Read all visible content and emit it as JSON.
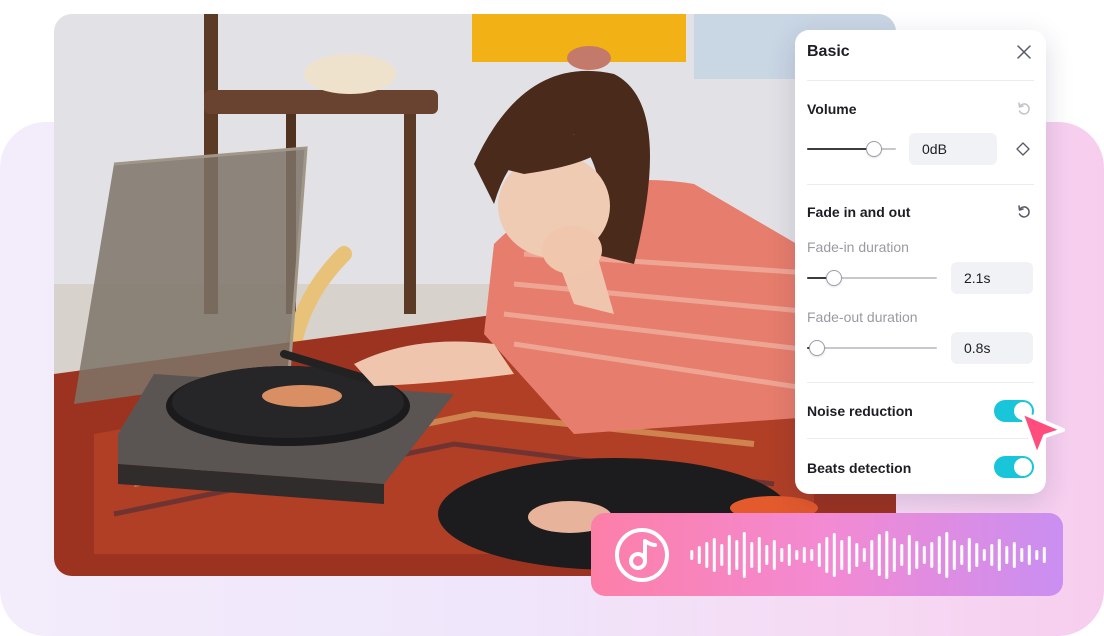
{
  "panel": {
    "title": "Basic",
    "volume": {
      "label": "Volume",
      "value": "0dB",
      "level": 0.75
    },
    "fade": {
      "label": "Fade in and out",
      "fade_in": {
        "label": "Fade-in duration",
        "value": "2.1s",
        "level": 0.21
      },
      "fade_out": {
        "label": "Fade-out duration",
        "value": "0.8s",
        "level": 0.08
      }
    },
    "noise_reduction": {
      "label": "Noise reduction",
      "enabled": true
    },
    "beats_detection": {
      "label": "Beats detection",
      "enabled": true
    }
  },
  "icons": [
    "close-icon",
    "reset-icon",
    "keyframe-diamond-icon",
    "pointer-cursor-icon",
    "music-note-icon",
    "waveform-icon"
  ],
  "colors": {
    "toggle_on": "#19c6d9",
    "cursor": "#ff4d7e",
    "audio_gradient_start": "#fc7fa8",
    "audio_gradient_end": "#c98ff1"
  }
}
